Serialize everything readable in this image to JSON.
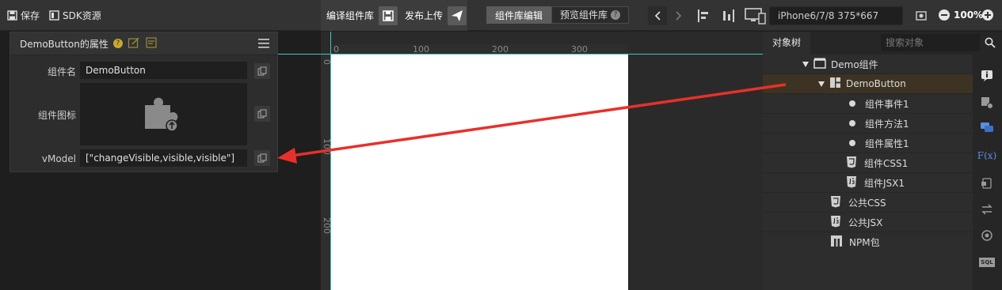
{
  "toolbar": {
    "save_label": "保存",
    "sdk_label": "SDK资源",
    "compile_label": "编译组件库",
    "publish_label": "发布上传",
    "edit_tab": "组件库编辑",
    "preview_tab": "预览组件库",
    "device": "iPhone6/7/8 375*667",
    "zoom": "100%"
  },
  "props": {
    "title": "DemoButton的属性",
    "name_label": "组件名",
    "name_value": "DemoButton",
    "icon_label": "组件图标",
    "vmodel_label": "vModel",
    "vmodel_value": "[\"changeVisible,visible,visible\"]"
  },
  "ruler": {
    "h_ticks": [
      "0",
      "100",
      "200",
      "300"
    ],
    "v_ticks": [
      "0",
      "100",
      "200"
    ]
  },
  "tree": {
    "tab": "对象树",
    "search_placeholder": "搜索对象",
    "items": [
      {
        "label": "Demo组件",
        "icon": "component-folder-icon"
      },
      {
        "label": "DemoButton",
        "icon": "block-icon"
      },
      {
        "label": "组件事件1",
        "icon": "bullet-icon"
      },
      {
        "label": "组件方法1",
        "icon": "bullet-icon"
      },
      {
        "label": "组件属性1",
        "icon": "bullet-icon"
      },
      {
        "label": "组件CSS1",
        "icon": "css3-icon"
      },
      {
        "label": "组件JSX1",
        "icon": "js-icon"
      },
      {
        "label": "公共CSS",
        "icon": "css3-icon"
      },
      {
        "label": "公共JSX",
        "icon": "js-icon"
      },
      {
        "label": "NPM包",
        "icon": "npm-icon"
      }
    ]
  },
  "rail": {
    "fx_label": "F(x)",
    "sql_label": "SQL"
  },
  "colors": {
    "accent": "#3ec7c0",
    "arrow": "#e8302a",
    "selected_row": "#3d3322"
  }
}
